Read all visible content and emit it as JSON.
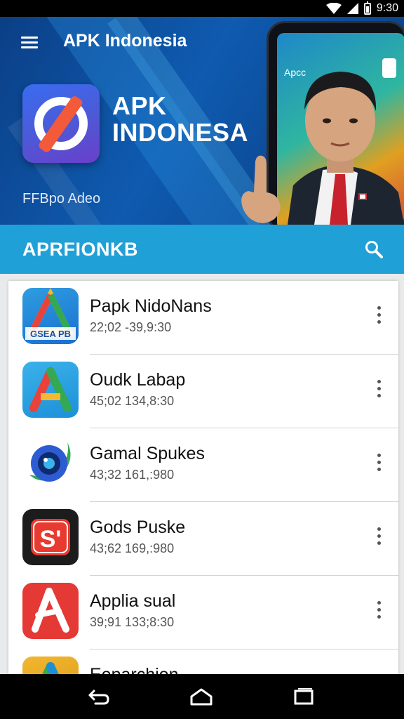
{
  "status_bar": {
    "time": "9:30"
  },
  "header": {
    "app_title": "APK Indonesia",
    "brand_line1": "APK",
    "brand_line2": "INDONESA",
    "subtitle": "FFBpo Adeo",
    "phone_screen_text": "Apcc"
  },
  "toolbar": {
    "title": "APRFIONKB"
  },
  "apps": [
    {
      "name": "Papk NidoNans",
      "meta": "22;02   -39,9:30",
      "icon_text": "GSEA PB",
      "icon": "a-triangle-icon"
    },
    {
      "name": "Oudk Labap",
      "meta": "45;02   134,8:30",
      "icon": "a-triangle-icon"
    },
    {
      "name": "Gamal Spukes",
      "meta": "43;32   161,:980",
      "icon": "camera-lens-icon"
    },
    {
      "name": "Gods Puske",
      "meta": "43;62   169,:980",
      "icon_text": "S'",
      "icon": "s-logo-icon"
    },
    {
      "name": "Applia sual",
      "meta": "39;91   133;8:30",
      "icon": "a-letter-icon"
    },
    {
      "name": "Eoparchion",
      "meta": "",
      "icon": "a-triangle-icon"
    }
  ],
  "colors": {
    "toolbar": "#1fa0d6",
    "hero": "#0f5bb0",
    "accent_red": "#e53935"
  }
}
